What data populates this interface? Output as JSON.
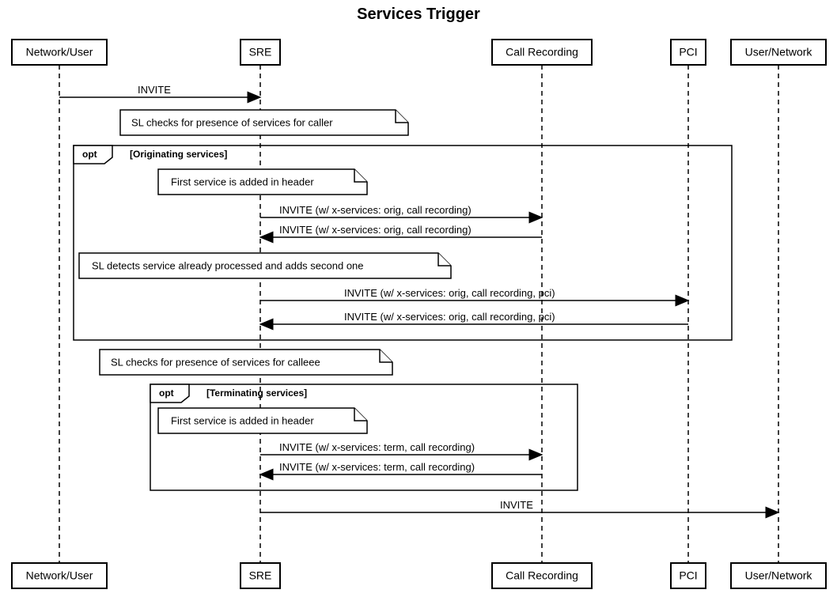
{
  "title": "Services Trigger",
  "actors": [
    {
      "id": "a0",
      "label": "Network/User"
    },
    {
      "id": "a1",
      "label": "SRE"
    },
    {
      "id": "a2",
      "label": "Call Recording"
    },
    {
      "id": "a3",
      "label": "PCI"
    },
    {
      "id": "a4",
      "label": "User/Network"
    }
  ],
  "messages": {
    "m1": "INVITE",
    "m2": "INVITE (w/ x-services: orig, call recording)",
    "m3": "INVITE (w/ x-services: orig, call recording)",
    "m4": "INVITE (w/ x-services: orig, call recording, pci)",
    "m5": "INVITE (w/ x-services: orig, call recording, pci)",
    "m6": "INVITE (w/ x-services: term, call recording)",
    "m7": "INVITE (w/ x-services: term, call recording)",
    "m8": "INVITE"
  },
  "notes": {
    "n1": "SL checks for presence of services for caller",
    "n2": "First service is added in header",
    "n3": "SL detects service already processed and adds second one",
    "n4": "SL checks for presence of services for calleee",
    "n5": "First service is added in header"
  },
  "fragments": {
    "f1": {
      "tag": "opt",
      "guard": "[Originating services]"
    },
    "f2": {
      "tag": "opt",
      "guard": "[Terminating services]"
    }
  },
  "chart_data": {
    "type": "sequence-diagram",
    "title": "Services Trigger",
    "participants": [
      "Network/User",
      "SRE",
      "Call Recording",
      "PCI",
      "User/Network"
    ],
    "events": [
      {
        "kind": "message",
        "from": "Network/User",
        "to": "SRE",
        "label": "INVITE"
      },
      {
        "kind": "note",
        "over": "SRE",
        "text": "SL checks for presence of services for caller"
      },
      {
        "kind": "fragment-start",
        "type": "opt",
        "guard": "[Originating services]",
        "span": [
          "Network/User",
          "PCI"
        ]
      },
      {
        "kind": "note",
        "over": "SRE",
        "text": "First service is added in header"
      },
      {
        "kind": "message",
        "from": "SRE",
        "to": "Call Recording",
        "label": "INVITE (w/ x-services: orig, call recording)"
      },
      {
        "kind": "message",
        "from": "Call Recording",
        "to": "SRE",
        "label": "INVITE (w/ x-services: orig, call recording)"
      },
      {
        "kind": "note",
        "over": "SRE",
        "text": "SL detects service already processed and adds second one"
      },
      {
        "kind": "message",
        "from": "SRE",
        "to": "PCI",
        "label": "INVITE (w/ x-services: orig, call recording, pci)"
      },
      {
        "kind": "message",
        "from": "PCI",
        "to": "SRE",
        "label": "INVITE (w/ x-services: orig, call recording, pci)"
      },
      {
        "kind": "fragment-end"
      },
      {
        "kind": "note",
        "over": "SRE",
        "text": "SL checks for presence of services for calleee"
      },
      {
        "kind": "fragment-start",
        "type": "opt",
        "guard": "[Terminating services]",
        "span": [
          "SRE",
          "Call Recording"
        ]
      },
      {
        "kind": "note",
        "over": "SRE",
        "text": "First service is added in header"
      },
      {
        "kind": "message",
        "from": "SRE",
        "to": "Call Recording",
        "label": "INVITE (w/ x-services: term, call recording)"
      },
      {
        "kind": "message",
        "from": "Call Recording",
        "to": "SRE",
        "label": "INVITE (w/ x-services: term, call recording)"
      },
      {
        "kind": "fragment-end"
      },
      {
        "kind": "message",
        "from": "SRE",
        "to": "User/Network",
        "label": "INVITE"
      }
    ]
  }
}
